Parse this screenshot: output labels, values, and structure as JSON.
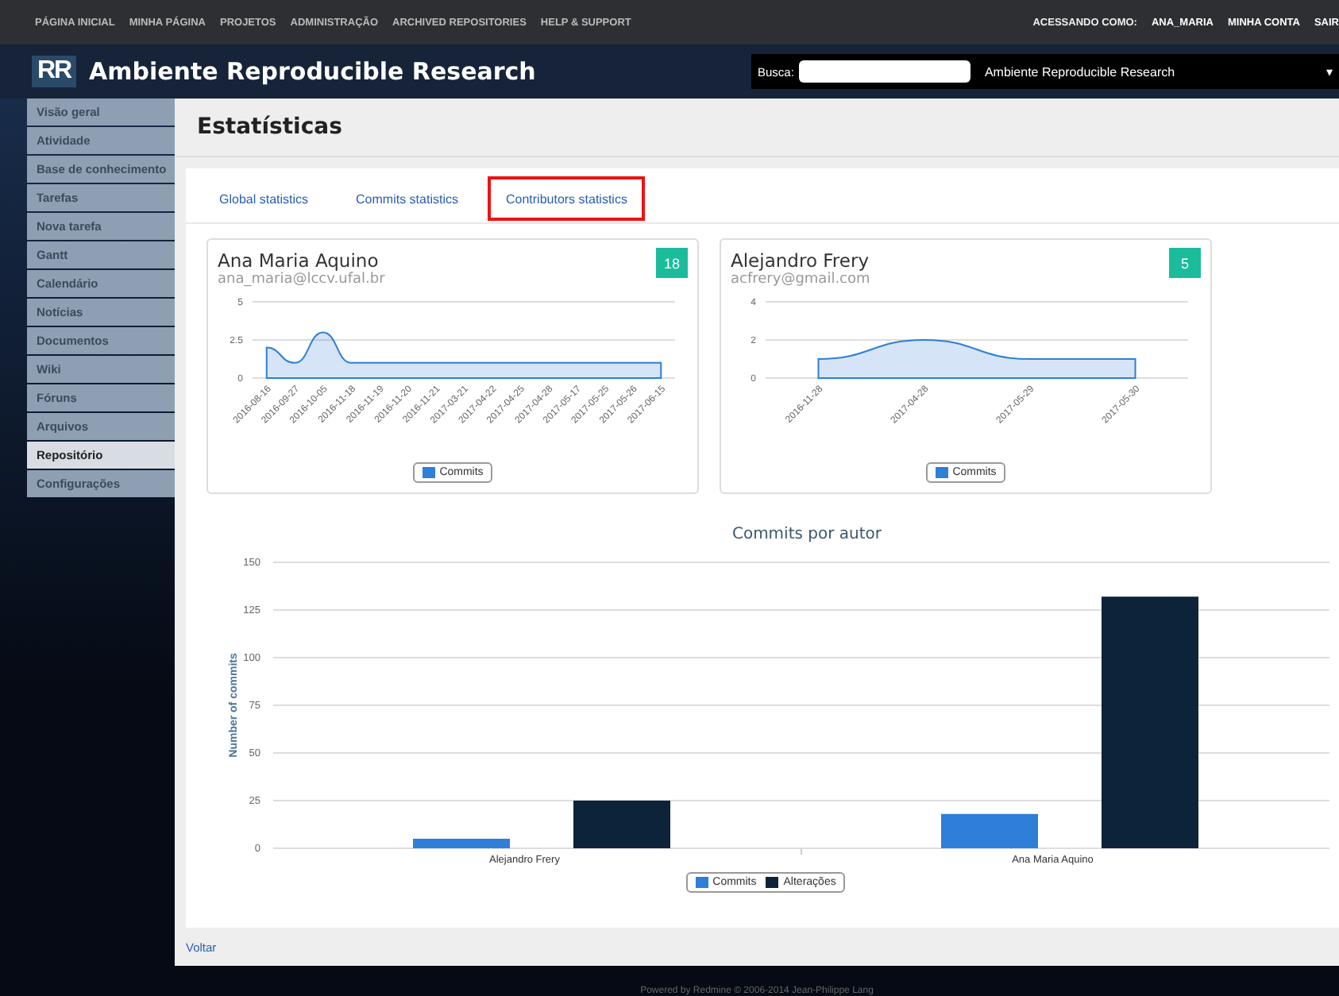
{
  "top_menu": {
    "items": [
      "PÁGINA INICIAL",
      "MINHA PÁGINA",
      "PROJETOS",
      "ADMINISTRAÇÃO",
      "ARCHIVED REPOSITORIES",
      "HELP & SUPPORT"
    ],
    "logged_label": "ACESSANDO COMO:",
    "user": "ANA_MARIA",
    "account_items": [
      "MINHA CONTA",
      "SAIR"
    ]
  },
  "header": {
    "logo": "RR",
    "title": "Ambiente Reproducible Research",
    "search_label": "Busca:",
    "project_select": "Ambiente Reproducible Research",
    "select_caret": "▾"
  },
  "sidebar": {
    "items": [
      {
        "label": "Visão geral",
        "selected": false
      },
      {
        "label": "Atividade",
        "selected": false
      },
      {
        "label": "Base de conhecimento",
        "selected": false
      },
      {
        "label": "Tarefas",
        "selected": false
      },
      {
        "label": "Nova tarefa",
        "selected": false
      },
      {
        "label": "Gantt",
        "selected": false
      },
      {
        "label": "Calendário",
        "selected": false
      },
      {
        "label": "Notícias",
        "selected": false
      },
      {
        "label": "Documentos",
        "selected": false
      },
      {
        "label": "Wiki",
        "selected": false
      },
      {
        "label": "Fóruns",
        "selected": false
      },
      {
        "label": "Arquivos",
        "selected": false
      },
      {
        "label": "Repositório",
        "selected": true
      },
      {
        "label": "Configurações",
        "selected": false
      }
    ]
  },
  "page_title": "Estatísticas",
  "tabs": [
    {
      "label": "Global statistics",
      "selected": false
    },
    {
      "label": "Commits statistics",
      "selected": false
    },
    {
      "label": "Contributors statistics",
      "selected": true
    }
  ],
  "contributors": [
    {
      "name": "Ana Maria Aquino",
      "email": "ana_maria@lccv.ufal.br",
      "count": "18",
      "chart_data": {
        "type": "area",
        "categories": [
          "2016-08-16",
          "2016-09-27",
          "2016-10-05",
          "2016-11-18",
          "2016-11-19",
          "2016-11-20",
          "2016-11-21",
          "2017-03-21",
          "2017-04-22",
          "2017-04-25",
          "2017-04-28",
          "2017-05-17",
          "2017-05-25",
          "2017-05-26",
          "2017-06-15"
        ],
        "series": [
          {
            "name": "Commits",
            "color": "#2f7ed8",
            "values": [
              2,
              1,
              3,
              1,
              1,
              1,
              1,
              1,
              1,
              1,
              1,
              1,
              1,
              1,
              1
            ]
          }
        ],
        "ylim": [
          0,
          5
        ],
        "yticks": [
          0,
          2.5,
          5
        ],
        "grid": true
      }
    },
    {
      "name": "Alejandro Frery",
      "email": "acfrery@gmail.com",
      "count": "5",
      "chart_data": {
        "type": "area",
        "categories": [
          "2016-11-28",
          "2017-04-28",
          "2017-05-29",
          "2017-05-30"
        ],
        "series": [
          {
            "name": "Commits",
            "color": "#2f7ed8",
            "values": [
              1,
              2,
              1,
              1
            ]
          }
        ],
        "ylim": [
          0,
          4
        ],
        "yticks": [
          0,
          2,
          4
        ],
        "grid": true
      }
    }
  ],
  "authors_chart": {
    "chart_data": {
      "type": "bar",
      "title": "Commits por autor",
      "ylabel": "Number of commits",
      "categories": [
        "Alejandro Frery",
        "Ana Maria Aquino"
      ],
      "series": [
        {
          "name": "Commits",
          "color": "#2f7ed8",
          "values": [
            5,
            18
          ]
        },
        {
          "name": "Alterações",
          "color": "#0d233a",
          "values": [
            25,
            132
          ]
        }
      ],
      "ylim": [
        0,
        150
      ],
      "yticks": [
        0,
        25,
        50,
        75,
        100,
        125,
        150
      ],
      "grid": true
    }
  },
  "back_link": "Voltar",
  "footer": "Powered by Redmine © 2006-2014 Jean-Philippe Lang"
}
